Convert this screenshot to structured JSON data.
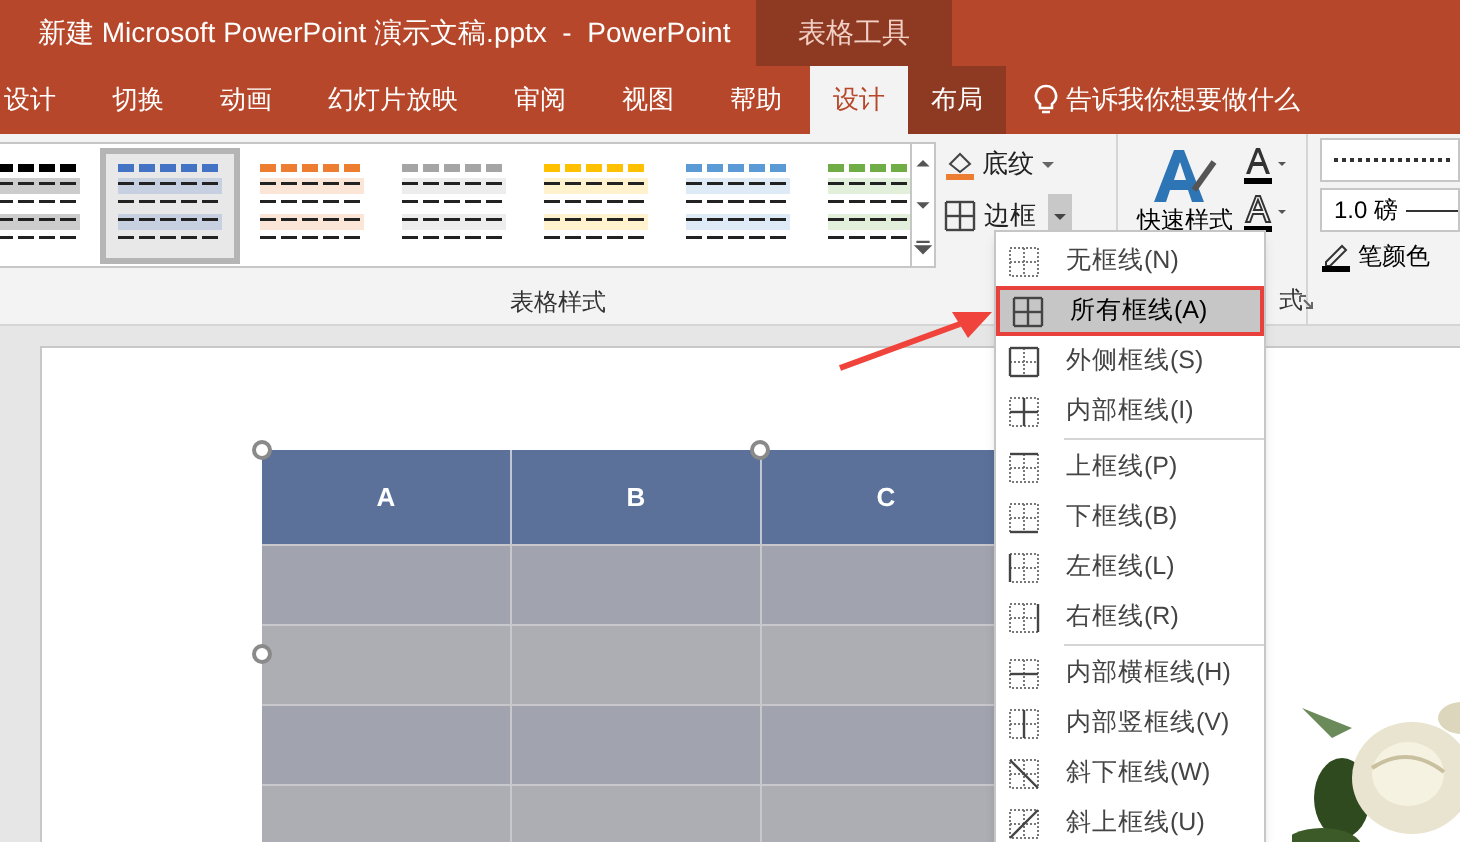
{
  "window": {
    "title": "新建 Microsoft PowerPoint 演示文稿.pptx  -  PowerPoint",
    "context_tab": "表格工具"
  },
  "tabs": [
    {
      "label": "设计",
      "selected": false,
      "context": false
    },
    {
      "label": "切换",
      "selected": false,
      "context": false
    },
    {
      "label": "动画",
      "selected": false,
      "context": false
    },
    {
      "label": "幻灯片放映",
      "selected": false,
      "context": false
    },
    {
      "label": "审阅",
      "selected": false,
      "context": false
    },
    {
      "label": "视图",
      "selected": false,
      "context": false
    },
    {
      "label": "帮助",
      "selected": false,
      "context": false
    },
    {
      "label": "设计",
      "selected": true,
      "context": true
    },
    {
      "label": "布局",
      "selected": false,
      "context": true
    }
  ],
  "tell_me": "告诉我你想要做什么",
  "table_styles": {
    "group_label": "表格样式",
    "styles": [
      {
        "color": "#000000",
        "selected": false
      },
      {
        "color": "#4472c4",
        "selected": true
      },
      {
        "color": "#ed7d31",
        "selected": false
      },
      {
        "color": "#a5a5a5",
        "selected": false
      },
      {
        "color": "#ffc000",
        "selected": false
      },
      {
        "color": "#5b9bd5",
        "selected": false
      },
      {
        "color": "#70ad47",
        "selected": false
      }
    ]
  },
  "shading": {
    "label": "底纹"
  },
  "borders": {
    "label": "边框"
  },
  "quick_styles": {
    "label": "快速样式"
  },
  "wordart_group_label": "式",
  "pen": {
    "weight": "1.0 磅",
    "color_label": "笔颜色"
  },
  "border_menu": [
    {
      "label": "无框线(N)",
      "kind": "none",
      "selected": false
    },
    {
      "label": "所有框线(A)",
      "kind": "all",
      "selected": true
    },
    {
      "label": "外侧框线(S)",
      "kind": "outside",
      "selected": false
    },
    {
      "label": "内部框线(I)",
      "kind": "inside",
      "selected": false,
      "separator_after": true
    },
    {
      "label": "上框线(P)",
      "kind": "top",
      "selected": false
    },
    {
      "label": "下框线(B)",
      "kind": "bottom",
      "selected": false
    },
    {
      "label": "左框线(L)",
      "kind": "left",
      "selected": false
    },
    {
      "label": "右框线(R)",
      "kind": "right",
      "selected": false,
      "separator_after": true
    },
    {
      "label": "内部横框线(H)",
      "kind": "inner_h",
      "selected": false
    },
    {
      "label": "内部竖框线(V)",
      "kind": "inner_v",
      "selected": false
    },
    {
      "label": "斜下框线(W)",
      "kind": "diag_down",
      "selected": false
    },
    {
      "label": "斜上框线(U)",
      "kind": "diag_up",
      "selected": false
    }
  ],
  "slide_table": {
    "columns": [
      "A",
      "B",
      "C"
    ],
    "body_rows": [
      {
        "dark": true
      },
      {
        "dark": false
      },
      {
        "dark": true
      },
      {
        "dark": false
      }
    ]
  }
}
